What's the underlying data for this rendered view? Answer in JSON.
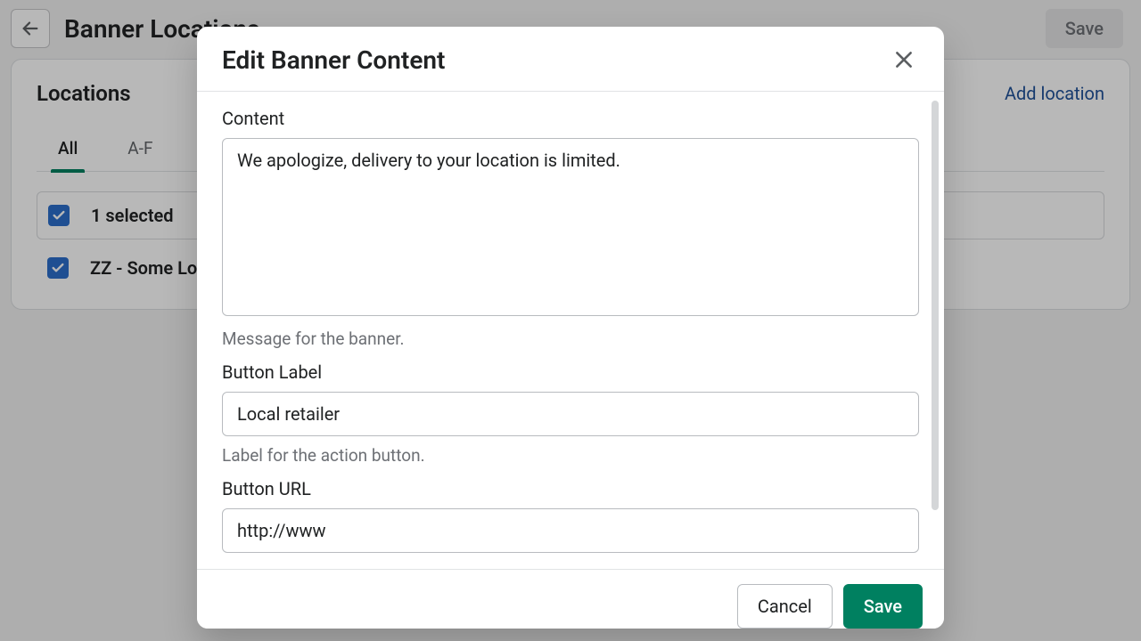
{
  "page": {
    "title": "Banner Locations",
    "saveLabel": "Save"
  },
  "card": {
    "title": "Locations",
    "addLabel": "Add location",
    "tabs": [
      "All",
      "A-F"
    ],
    "selectedCount": "1 selected",
    "rows": [
      "ZZ - Some Location"
    ]
  },
  "modal": {
    "title": "Edit Banner Content",
    "fields": {
      "content": {
        "label": "Content",
        "value": "We apologize, delivery to your location is limited.",
        "help": "Message for the banner."
      },
      "buttonLabel": {
        "label": "Button Label",
        "value": "Local retailer",
        "help": "Label for the action button."
      },
      "buttonUrl": {
        "label": "Button URL",
        "value": "http://www"
      }
    },
    "cancelLabel": "Cancel",
    "saveLabel": "Save"
  }
}
